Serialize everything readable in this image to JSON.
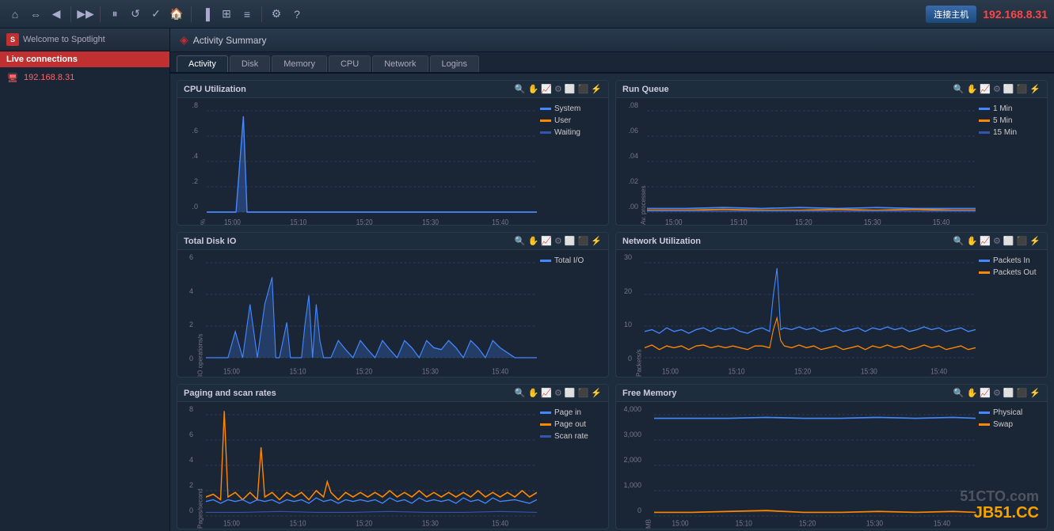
{
  "toolbar": {
    "ip": "192.168.8.31",
    "connect_label": "连接主机"
  },
  "sidebar": {
    "title": "Welcome to Spotlight",
    "section_label": "Live connections",
    "server_ip": "192.168.8.31"
  },
  "activity_summary": {
    "title": "Activity Summary",
    "tabs": [
      "Activity",
      "Disk",
      "Memory",
      "CPU",
      "Network",
      "Logins"
    ]
  },
  "charts": {
    "cpu_util": {
      "title": "CPU Utilization",
      "yaxis_label": "%",
      "yvalues": [
        ".8",
        ".6",
        ".4",
        ".2",
        ".0"
      ],
      "xvalues": [
        "15:00",
        "15:10",
        "15:20",
        "15:30",
        "15:40"
      ],
      "legend": [
        {
          "label": "System",
          "color": "#4488ff"
        },
        {
          "label": "User",
          "color": "#ff8800"
        },
        {
          "label": "Waiting",
          "color": "#3355aa"
        }
      ]
    },
    "run_queue": {
      "title": "Run Queue",
      "yaxis_label": "Av. processes",
      "yvalues": [
        ".08",
        ".06",
        ".04",
        ".02",
        ".00"
      ],
      "xvalues": [
        "15:00",
        "15:10",
        "15:20",
        "15:30",
        "15:40"
      ],
      "legend": [
        {
          "label": "1 Min",
          "color": "#4488ff"
        },
        {
          "label": "5 Min",
          "color": "#ff8800"
        },
        {
          "label": "15 Min",
          "color": "#3355aa"
        }
      ]
    },
    "disk_io": {
      "title": "Total Disk IO",
      "yaxis_label": "IO operations/s",
      "yvalues": [
        "6",
        "4",
        "2",
        "0"
      ],
      "xvalues": [
        "15:00",
        "15:10",
        "15:20",
        "15:30",
        "15:40"
      ],
      "legend": [
        {
          "label": "Total I/O",
          "color": "#4488ff"
        }
      ]
    },
    "network_util": {
      "title": "Network Utilization",
      "yaxis_label": "Packets/s",
      "yvalues": [
        "30",
        "20",
        "10",
        "0"
      ],
      "xvalues": [
        "15:00",
        "15:10",
        "15:20",
        "15:30",
        "15:40"
      ],
      "legend": [
        {
          "label": "Packets In",
          "color": "#4488ff"
        },
        {
          "label": "Packets Out",
          "color": "#ff8800"
        }
      ]
    },
    "paging": {
      "title": "Paging and scan rates",
      "yaxis_label": "Pages/second",
      "yvalues": [
        "8",
        "6",
        "4",
        "2",
        "0"
      ],
      "xvalues": [
        "15:00",
        "15:10",
        "15:20",
        "15:30",
        "15:40"
      ],
      "legend": [
        {
          "label": "Page in",
          "color": "#4488ff"
        },
        {
          "label": "Page out",
          "color": "#ff8800"
        },
        {
          "label": "Scan rate",
          "color": "#3355aa"
        }
      ]
    },
    "free_memory": {
      "title": "Free Memory",
      "yaxis_label": "MB",
      "yvalues": [
        "4,000",
        "3,000",
        "2,000",
        "1,000",
        "0"
      ],
      "xvalues": [
        "15:00",
        "15:10",
        "15:20",
        "15:30",
        "15:40"
      ],
      "legend": [
        {
          "label": "Physical",
          "color": "#4488ff"
        },
        {
          "label": "Swap",
          "color": "#ff8800"
        }
      ]
    }
  }
}
